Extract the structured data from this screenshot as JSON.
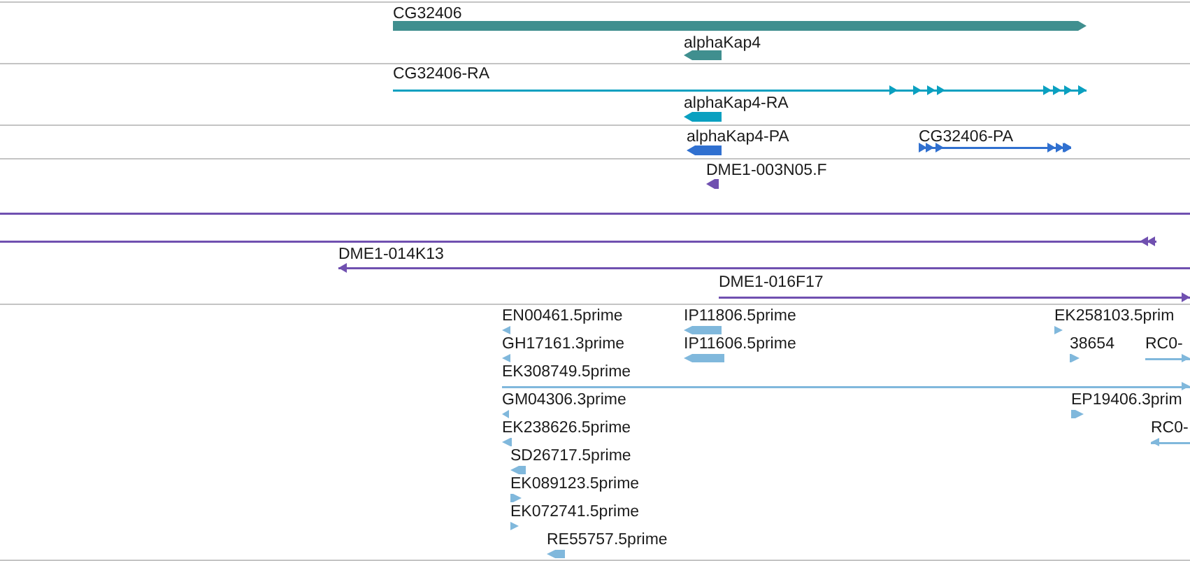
{
  "tracks": [
    {
      "color": "#408f8f",
      "features": [
        {
          "label": "CG32406",
          "kind": "bar",
          "reverse": false
        },
        {
          "label": "alphaKap4",
          "kind": "bar",
          "reverse": true
        }
      ]
    },
    {
      "color": "#0aa0c0",
      "features": [
        {
          "label": "CG32406-RA",
          "kind": "line",
          "reverse": false
        },
        {
          "label": "alphaKap4-RA",
          "kind": "bar",
          "reverse": true
        }
      ]
    },
    {
      "color": "#3070d0",
      "features": [
        {
          "label": "alphaKap4-PA",
          "kind": "bar",
          "reverse": true
        },
        {
          "label": "CG32406-PA",
          "kind": "line",
          "reverse": false
        }
      ]
    },
    {
      "color": "#7050b0",
      "features": [
        {
          "label": "DME1-003N05.F",
          "kind": "bar",
          "reverse": true
        },
        {
          "kind": "line"
        },
        {
          "kind": "line",
          "reverse": true
        },
        {
          "label": "DME1-014K13",
          "kind": "line",
          "reverse": true
        },
        {
          "label": "DME1-016F17",
          "kind": "line",
          "reverse": false
        }
      ]
    },
    {
      "color": "#80b8dc",
      "features": [
        {
          "label": "EN00461.5prime",
          "kind": "bar",
          "reverse": true
        },
        {
          "label": "IP11806.5prime",
          "kind": "bar",
          "reverse": true
        },
        {
          "label": "EK258103.5prim",
          "kind": "bar",
          "reverse": false
        },
        {
          "label": "GH17161.3prime",
          "kind": "bar",
          "reverse": true
        },
        {
          "label": "IP11606.5prime",
          "kind": "bar",
          "reverse": true
        },
        {
          "label": "38654",
          "kind": "bar",
          "reverse": false
        },
        {
          "label": "RC0-",
          "kind": "line",
          "reverse": false
        },
        {
          "label": "EK308749.5prime",
          "kind": "line",
          "reverse": false
        },
        {
          "label": "GM04306.3prime",
          "kind": "bar",
          "reverse": true
        },
        {
          "label": "EP19406.3prim",
          "kind": "bar",
          "reverse": false
        },
        {
          "label": "EK238626.5prime",
          "kind": "bar",
          "reverse": true
        },
        {
          "label": "RC0-",
          "kind": "line",
          "reverse": true
        },
        {
          "label": "SD26717.5prime",
          "kind": "bar",
          "reverse": true
        },
        {
          "label": "EK089123.5prime",
          "kind": "bar",
          "reverse": false
        },
        {
          "label": "EK072741.5prime",
          "kind": "bar",
          "reverse": false
        },
        {
          "label": "RE55757.5prime",
          "kind": "bar",
          "reverse": true
        }
      ]
    }
  ]
}
